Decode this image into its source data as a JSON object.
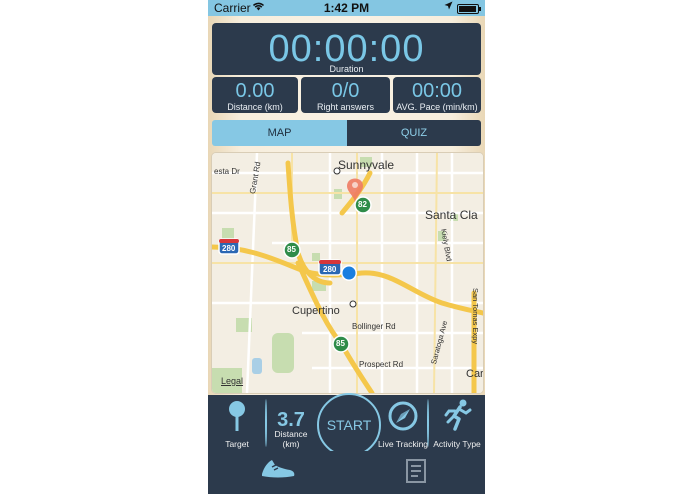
{
  "status_bar": {
    "carrier": "Carrier",
    "time": "1:42 PM"
  },
  "stats": {
    "duration": {
      "value": "00:00:00",
      "label": "Duration"
    },
    "distance": {
      "value": "0.00",
      "label": "Distance (km)"
    },
    "answers": {
      "value": "0/0",
      "label": "Right answers"
    },
    "pace": {
      "value": "00:00",
      "label": "AVG. Pace (min/km)"
    }
  },
  "segmented": {
    "map_label": "MAP",
    "quiz_label": "QUIZ",
    "selected": "MAP"
  },
  "map": {
    "labels": {
      "sunnyvale": "Sunnyvale",
      "santa_clara": "Santa Cla",
      "cupertino": "Cupertino",
      "esta_dr": "esta Dr",
      "grant_rd": "Grant Rd",
      "kiely_blvd": "Kiely Blvd",
      "bollinger_rd": "Bollinger Rd",
      "saratoga_ave": "Saratoga Ave",
      "prospect_rd": "Prospect Rd",
      "san_tomas_expy": "San Tomas Expy",
      "car": "Car",
      "legal": "Legal"
    },
    "shields": {
      "i280_left": "280",
      "i280_center": "280",
      "ca85_top": "85",
      "ca85_bottom": "85",
      "ca82": "82"
    }
  },
  "toolbar": {
    "target_label": "Target",
    "distance_value": "3.7",
    "distance_label": "Distance (km)",
    "start_label": "START",
    "live_label": "Live Tracking",
    "activity_label": "Activity Type"
  },
  "colors": {
    "panel": "#2c3a4c",
    "accent": "#86c8e4",
    "status_bar": "#84c6e2"
  },
  "icons": {
    "target": "pin-icon",
    "live": "compass-icon",
    "activity": "runner-icon",
    "tab_run": "shoe-icon",
    "tab_history": "list-document-icon"
  }
}
